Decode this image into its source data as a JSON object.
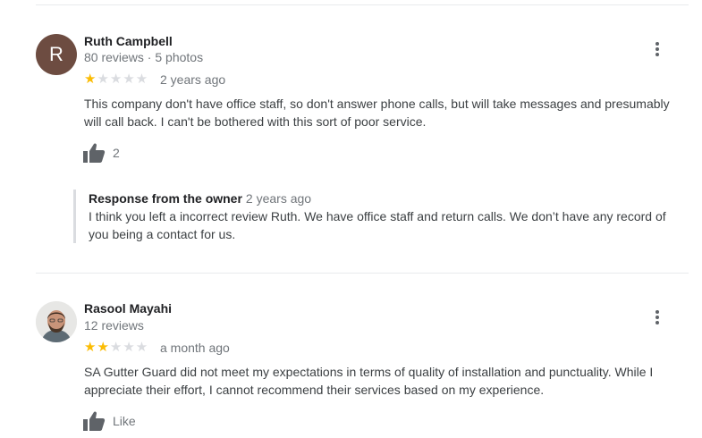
{
  "reviews": [
    {
      "avatar_letter": "R",
      "author": "Ruth Campbell",
      "meta": "80 reviews · 5 photos",
      "rating": 1,
      "stars_filled": "★",
      "stars_empty": "★★★★",
      "time": "2 years ago",
      "text": "This company don't have office staff, so don't answer phone calls, but will take messages and presumably will call back. I can't be bothered with this sort of poor service.",
      "like_label": "2",
      "owner_response": {
        "title": "Response from the owner",
        "time": "2 years ago",
        "text": "I think you left a incorrect review Ruth. We have office staff and return calls. We don’t have any record of you being a contact for us."
      }
    },
    {
      "author": "Rasool Mayahi",
      "meta": "12 reviews",
      "rating": 2,
      "stars_filled": "★★",
      "stars_empty": "★★★",
      "time": "a month ago",
      "text": "SA Gutter Guard did not meet my expectations in terms of quality of installation and punctuality. While I appreciate their effort, I cannot recommend their services based on my experience.",
      "like_label": "Like"
    }
  ],
  "colors": {
    "star": "#fbbc04",
    "star_empty": "#dadce0",
    "avatar_bg": "#6d4c41"
  }
}
